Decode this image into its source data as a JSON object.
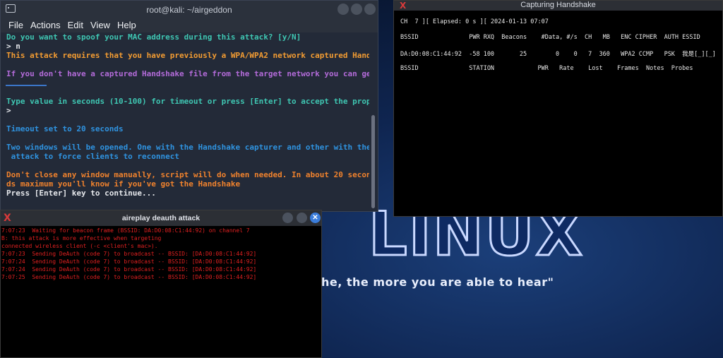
{
  "wallpaper": {
    "logo_text": "LINUX",
    "quote": "he, the more you are able to hear\""
  },
  "main_terminal": {
    "title": "root@kali: ~/airgeddon",
    "menu": [
      "File",
      "Actions",
      "Edit",
      "View",
      "Help"
    ],
    "lines": [
      {
        "text": "Do you want to spoof your MAC address during this attack? [y/N]",
        "color": "cyan"
      },
      {
        "text": "> n",
        "color": "white"
      },
      {
        "text": "This attack requires that you have previously a WPA/WPA2 network captured Hand",
        "color": "orange"
      },
      {
        "text": "",
        "color": "white"
      },
      {
        "text": "If you don't have a captured Handshake file from the target network you can ge",
        "color": "purple"
      },
      {
        "text": "",
        "color": "white"
      },
      {
        "text": "",
        "color": "white"
      },
      {
        "text": "Type value in seconds (10-100) for timeout or press [Enter] to accept the prop",
        "color": "cyan"
      },
      {
        "text": ">",
        "color": "white"
      },
      {
        "text": "",
        "color": "white"
      },
      {
        "text": "Timeout set to 20 seconds",
        "color": "blue"
      },
      {
        "text": "",
        "color": "white"
      },
      {
        "text": "Two windows will be opened. One with the Handshake capturer and other with the",
        "color": "blue"
      },
      {
        "text": " attack to force clients to reconnect",
        "color": "blue"
      },
      {
        "text": "",
        "color": "white"
      },
      {
        "text": "Don't close any window manually, script will do when needed. In about 20 secon",
        "color": "orange2"
      },
      {
        "text": "ds maximum you'll know if you've got the Handshake",
        "color": "orange2"
      },
      {
        "text": "Press [Enter] key to continue...",
        "color": "white"
      }
    ]
  },
  "capture_window": {
    "title": "Capturing Handshake",
    "rows": [
      "",
      "CH  7 ][ Elapsed: 0 s ][ 2024-01-13 07:07",
      "",
      "BSSID              PWR RXQ  Beacons    #Data, #/s  CH   MB   ENC CIPHER  AUTH ESSID",
      "",
      "DA:D0:08:C1:44:92  -58 100       25        0    0   7  360   WPA2 CCMP   PSK  我是[_][_]",
      "",
      "BSSID              STATION            PWR   Rate    Lost    Frames  Notes  Probes"
    ]
  },
  "deauth_window": {
    "title": "aireplay deauth attack",
    "rows": [
      "7:07:23  Waiting for beacon frame (BSSID: DA:D0:08:C1:44:92) on channel 7",
      "B: this attack is more effective when targeting",
      "connected wireless client (-c <client's mac>).",
      "7:07:23  Sending DeAuth (code 7) to broadcast -- BSSID: [DA:D0:08:C1:44:92]",
      "7:07:24  Sending DeAuth (code 7) to broadcast -- BSSID: [DA:D0:08:C1:44:92]",
      "7:07:24  Sending DeAuth (code 7) to broadcast -- BSSID: [DA:D0:08:C1:44:92]",
      "7:07:25  Sending DeAuth (code 7) to broadcast -- BSSID: [DA:D0:08:C1:44:92]"
    ]
  },
  "colors": {
    "cyan": "#3fc6b2",
    "white": "#e7e9ed",
    "orange": "#f39c32",
    "purple": "#b36bd9",
    "blue": "#2f93e0",
    "orange2": "#f0822d",
    "deauth_red": "#e02020"
  }
}
